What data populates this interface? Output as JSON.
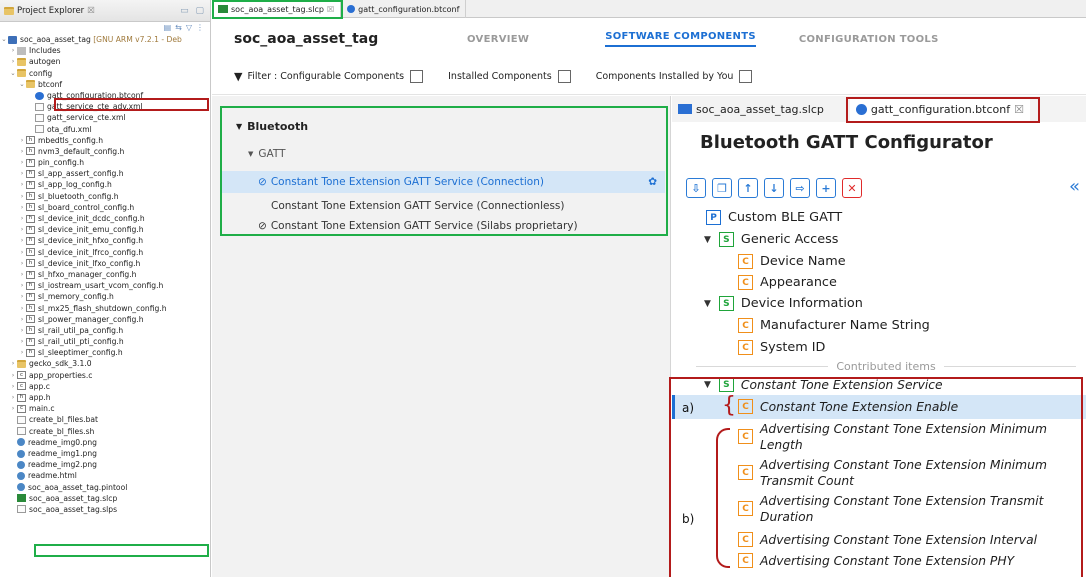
{
  "project_explorer": {
    "title": "Project Explorer",
    "root": {
      "name": "soc_aoa_asset_tag",
      "suffix": "[GNU ARM v7.2.1 - Deb"
    },
    "items": [
      {
        "label": "Includes",
        "indent": 1,
        "arrow": "›",
        "icon": "include"
      },
      {
        "label": "autogen",
        "indent": 1,
        "arrow": "›",
        "icon": "folder"
      },
      {
        "label": "config",
        "indent": 1,
        "arrow": "⌄",
        "icon": "folder"
      },
      {
        "label": "btconf",
        "indent": 2,
        "arrow": "⌄",
        "icon": "folder"
      },
      {
        "label": "gatt_configuration.btconf",
        "indent": 3,
        "arrow": "",
        "icon": "bt"
      },
      {
        "label": "gatt_service_cte_adv.xml",
        "indent": 3,
        "arrow": "",
        "icon": "file"
      },
      {
        "label": "gatt_service_cte.xml",
        "indent": 3,
        "arrow": "",
        "icon": "file"
      },
      {
        "label": "ota_dfu.xml",
        "indent": 3,
        "arrow": "",
        "icon": "file"
      },
      {
        "label": "mbedtls_config.h",
        "indent": 2,
        "arrow": "›",
        "icon": "h"
      },
      {
        "label": "nvm3_default_config.h",
        "indent": 2,
        "arrow": "›",
        "icon": "h"
      },
      {
        "label": "pin_config.h",
        "indent": 2,
        "arrow": "›",
        "icon": "h"
      },
      {
        "label": "sl_app_assert_config.h",
        "indent": 2,
        "arrow": "›",
        "icon": "h"
      },
      {
        "label": "sl_app_log_config.h",
        "indent": 2,
        "arrow": "›",
        "icon": "h"
      },
      {
        "label": "sl_bluetooth_config.h",
        "indent": 2,
        "arrow": "›",
        "icon": "h"
      },
      {
        "label": "sl_board_control_config.h",
        "indent": 2,
        "arrow": "›",
        "icon": "h"
      },
      {
        "label": "sl_device_init_dcdc_config.h",
        "indent": 2,
        "arrow": "›",
        "icon": "h"
      },
      {
        "label": "sl_device_init_emu_config.h",
        "indent": 2,
        "arrow": "›",
        "icon": "h"
      },
      {
        "label": "sl_device_init_hfxo_config.h",
        "indent": 2,
        "arrow": "›",
        "icon": "h"
      },
      {
        "label": "sl_device_init_lfrco_config.h",
        "indent": 2,
        "arrow": "›",
        "icon": "h"
      },
      {
        "label": "sl_device_init_lfxo_config.h",
        "indent": 2,
        "arrow": "›",
        "icon": "h"
      },
      {
        "label": "sl_hfxo_manager_config.h",
        "indent": 2,
        "arrow": "›",
        "icon": "h"
      },
      {
        "label": "sl_iostream_usart_vcom_config.h",
        "indent": 2,
        "arrow": "›",
        "icon": "h"
      },
      {
        "label": "sl_memory_config.h",
        "indent": 2,
        "arrow": "›",
        "icon": "h"
      },
      {
        "label": "sl_mx25_flash_shutdown_config.h",
        "indent": 2,
        "arrow": "›",
        "icon": "h"
      },
      {
        "label": "sl_power_manager_config.h",
        "indent": 2,
        "arrow": "›",
        "icon": "h"
      },
      {
        "label": "sl_rail_util_pa_config.h",
        "indent": 2,
        "arrow": "›",
        "icon": "h"
      },
      {
        "label": "sl_rail_util_pti_config.h",
        "indent": 2,
        "arrow": "›",
        "icon": "h"
      },
      {
        "label": "sl_sleeptimer_config.h",
        "indent": 2,
        "arrow": "›",
        "icon": "h"
      },
      {
        "label": "gecko_sdk_3.1.0",
        "indent": 1,
        "arrow": "›",
        "icon": "folder"
      },
      {
        "label": "app_properties.c",
        "indent": 1,
        "arrow": "›",
        "icon": "c"
      },
      {
        "label": "app.c",
        "indent": 1,
        "arrow": "›",
        "icon": "c"
      },
      {
        "label": "app.h",
        "indent": 1,
        "arrow": "›",
        "icon": "h"
      },
      {
        "label": "main.c",
        "indent": 1,
        "arrow": "›",
        "icon": "c"
      },
      {
        "label": "create_bl_files.bat",
        "indent": 1,
        "arrow": "",
        "icon": "file"
      },
      {
        "label": "create_bl_files.sh",
        "indent": 1,
        "arrow": "",
        "icon": "file"
      },
      {
        "label": "readme_img0.png",
        "indent": 1,
        "arrow": "",
        "icon": "img"
      },
      {
        "label": "readme_img1.png",
        "indent": 1,
        "arrow": "",
        "icon": "img"
      },
      {
        "label": "readme_img2.png",
        "indent": 1,
        "arrow": "",
        "icon": "img"
      },
      {
        "label": "readme.html",
        "indent": 1,
        "arrow": "",
        "icon": "img"
      },
      {
        "label": "soc_aoa_asset_tag.pintool",
        "indent": 1,
        "arrow": "",
        "icon": "img"
      },
      {
        "label": "soc_aoa_asset_tag.slcp",
        "indent": 1,
        "arrow": "",
        "icon": "slcp"
      },
      {
        "label": "soc_aoa_asset_tag.slps",
        "indent": 1,
        "arrow": "",
        "icon": "file"
      }
    ]
  },
  "editor_tabs": [
    {
      "label": "soc_aoa_asset_tag.slcp",
      "close": "☒",
      "active": true
    },
    {
      "label": "gatt_configuration.btconf",
      "close": "",
      "active": false
    }
  ],
  "slcp": {
    "project_name": "soc_aoa_asset_tag",
    "nav": [
      "OVERVIEW",
      "SOFTWARE COMPONENTS",
      "CONFIGURATION TOOLS"
    ],
    "filter": {
      "label": "Filter :",
      "options": [
        "Configurable Components",
        "Installed Components",
        "Components Installed by You"
      ]
    },
    "components": {
      "category": "Bluetooth",
      "subcategory": "GATT",
      "items": [
        {
          "label": "Constant Tone Extension GATT Service (Connection)",
          "installed": true,
          "selected": true
        },
        {
          "label": "Constant Tone Extension GATT Service (Connectionless)",
          "installed": false,
          "selected": false
        },
        {
          "label": "Constant Tone Extension GATT Service (Silabs proprietary)",
          "installed": true,
          "selected": false
        }
      ]
    }
  },
  "gatt": {
    "tabs": [
      "soc_aoa_asset_tag.slcp",
      "gatt_configuration.btconf"
    ],
    "title": "Bluetooth GATT Configurator",
    "root": "Custom BLE GATT",
    "services": [
      {
        "name": "Generic Access",
        "chars": [
          "Device Name",
          "Appearance"
        ]
      },
      {
        "name": "Device Information",
        "chars": [
          "Manufacturer Name String",
          "System ID"
        ]
      }
    ],
    "contributed_label": "Contributed items",
    "contributed_service": "Constant Tone Extension Service",
    "contributed_chars": [
      "Constant Tone Extension Enable",
      "Advertising Constant Tone Extension Minimum Length",
      "Advertising Constant Tone Extension Minimum Transmit Count",
      "Advertising Constant Tone Extension Transmit Duration",
      "Advertising Constant Tone Extension Interval",
      "Advertising Constant Tone Extension PHY"
    ],
    "labels": [
      "a)",
      "b)"
    ]
  }
}
